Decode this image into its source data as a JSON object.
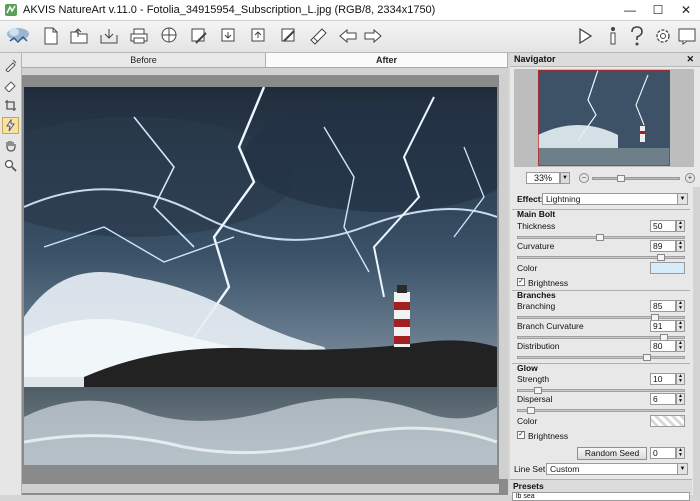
{
  "window": {
    "title": "AKVIS NatureArt v.11.0 - Fotolia_34915954_Subscription_L.jpg (RGB/8, 2334x1750)",
    "minimize": "—",
    "maximize": "☐",
    "close": "✕"
  },
  "tabs": {
    "before": "Before",
    "after": "After"
  },
  "navigator": {
    "title": "Navigator",
    "close": "✕",
    "zoom": "33%",
    "zoom_minus": "−",
    "zoom_plus": "+"
  },
  "settings": {
    "effect_label": "Effect:",
    "effect_value": "Lightning",
    "main_bolt": {
      "title": "Main Bolt",
      "thickness_label": "Thickness",
      "thickness_value": "50",
      "thickness_level": 0.5,
      "curvature_label": "Curvature",
      "curvature_value": "89",
      "curvature_level": 0.89,
      "color_label": "Color",
      "color": "#d6ecfb",
      "brightness_label": "Brightness"
    },
    "branches": {
      "title": "Branches",
      "branching_label": "Branching",
      "branching_value": "85",
      "branching_level": 0.85,
      "branch_curvature_label": "Branch Curvature",
      "branch_curvature_value": "91",
      "branch_curvature_level": 0.91,
      "distribution_label": "Distribution",
      "distribution_value": "80",
      "distribution_level": 0.8
    },
    "glow": {
      "title": "Glow",
      "strength_label": "Strength",
      "strength_value": "10",
      "strength_level": 0.1,
      "dispersal_label": "Dispersal",
      "dispersal_value": "6",
      "dispersal_level": 0.06,
      "color_label": "Color",
      "brightness_label": "Brightness"
    },
    "random_seed_label": "Random Seed",
    "random_seed_value": "0",
    "line_set_label": "Line Set",
    "line_set_value": "Custom",
    "presets_label": "Presets",
    "preset_value": "lb sea"
  },
  "colors": {
    "accent": "#f7e2a6",
    "panel": "#e8e8e8",
    "canvas_bg": "#8a8a8a"
  }
}
